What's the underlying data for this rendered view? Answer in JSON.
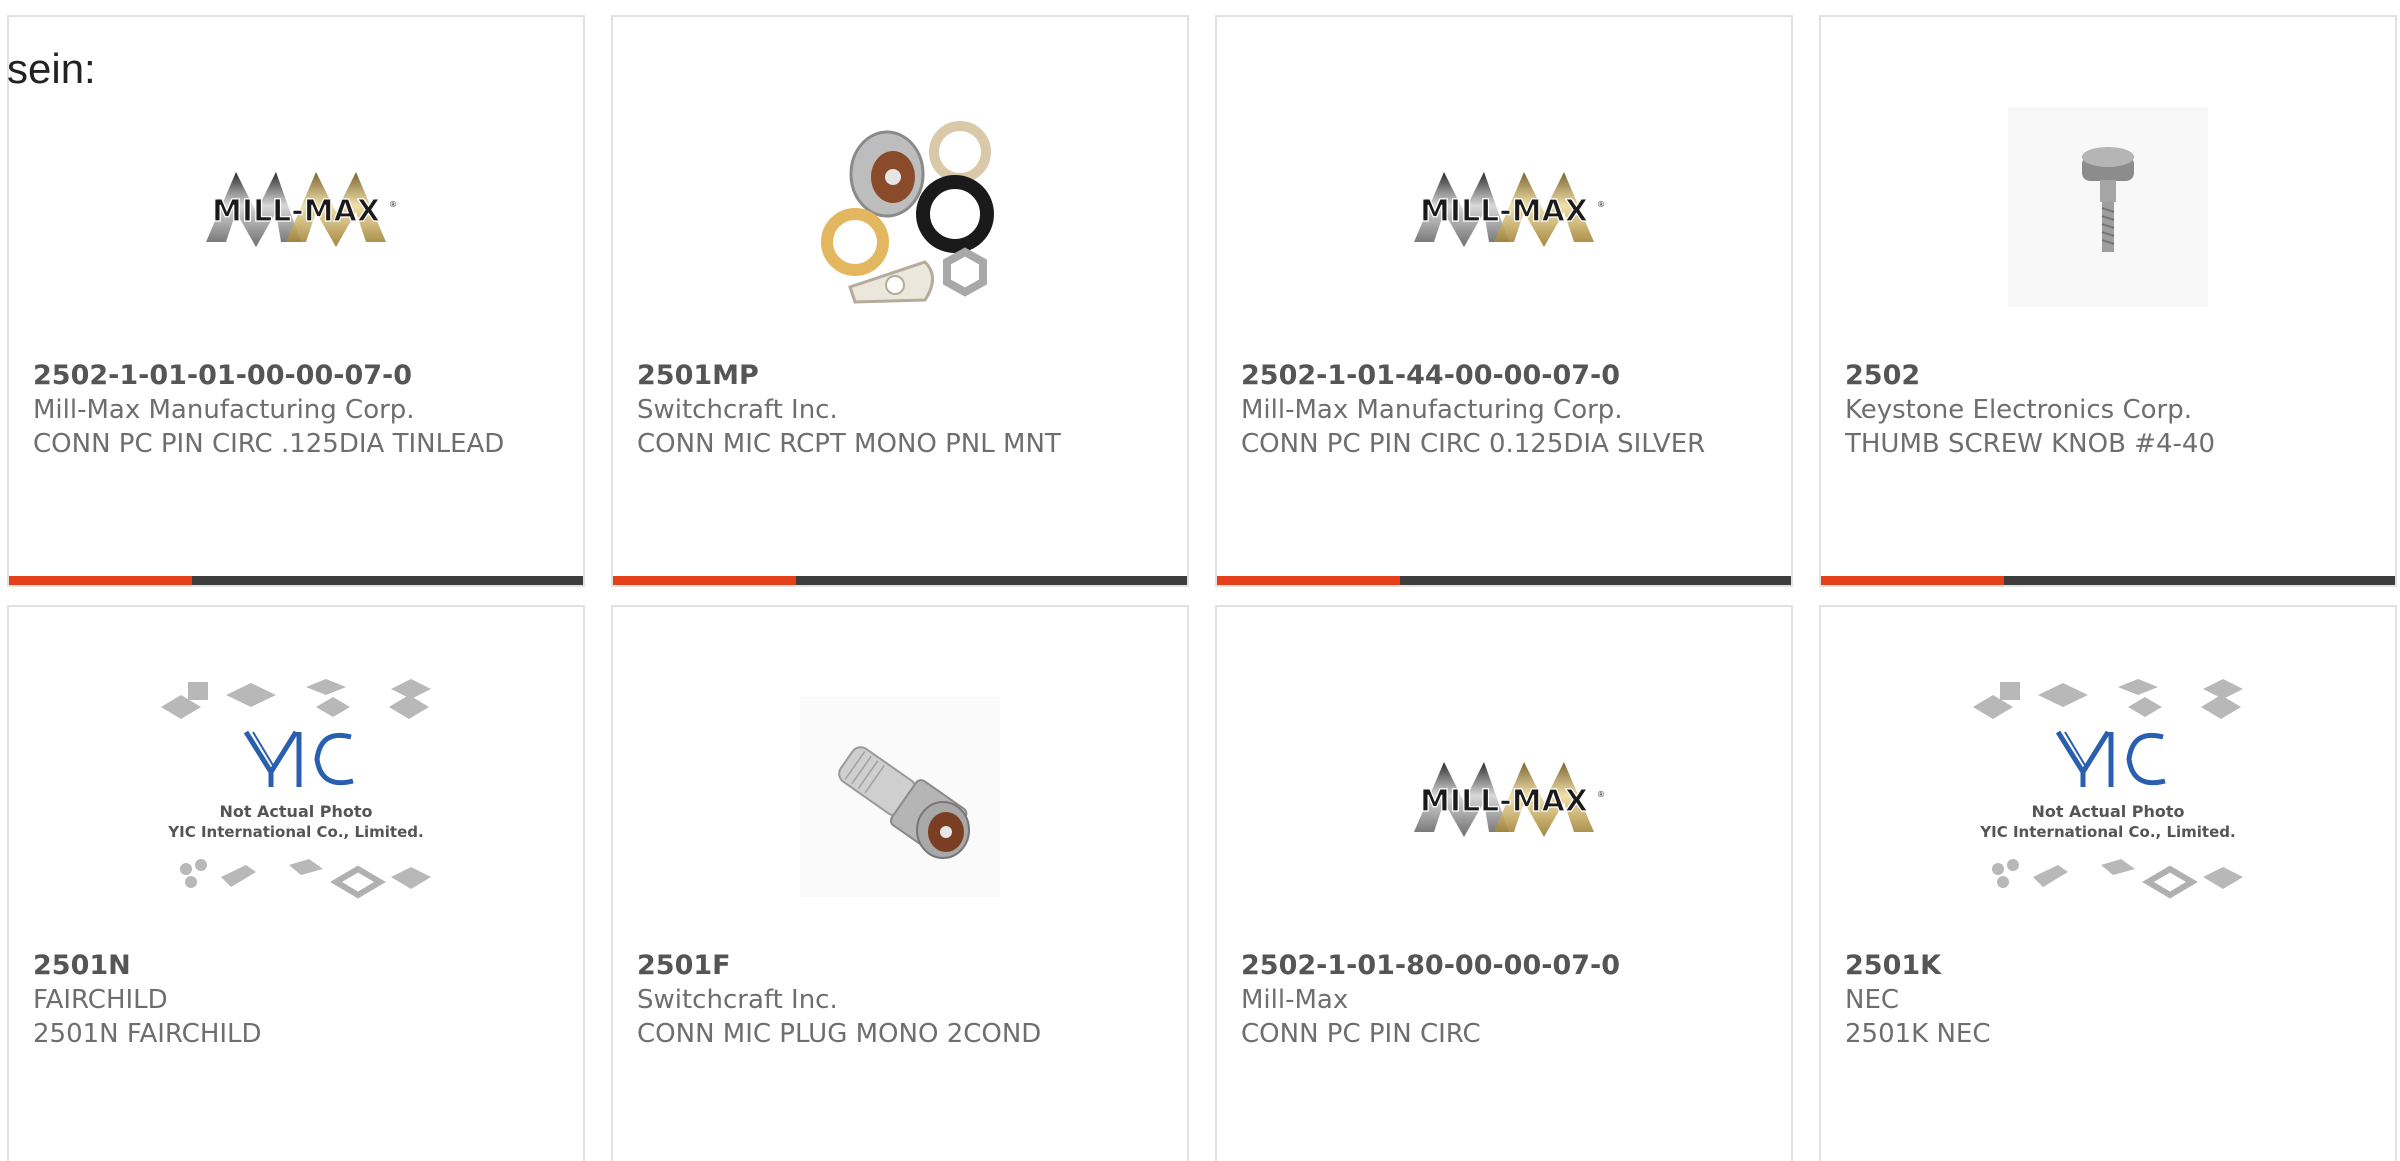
{
  "corner_label": "sein:",
  "products": [
    {
      "part": "2502-1-01-01-00-00-07-0",
      "manufacturer": "Mill-Max Manufacturing Corp.",
      "description": "CONN PC PIN CIRC .125DIA TINLEAD",
      "image": "millmax-logo",
      "logo_text": "MILL-MAX",
      "logo_mark": "®"
    },
    {
      "part": "2501MP",
      "manufacturer": "Switchcraft Inc.",
      "description": "CONN MIC RCPT MONO PNL MNT",
      "image": "mic-receptacle-photo"
    },
    {
      "part": "2502-1-01-44-00-00-07-0",
      "manufacturer": "Mill-Max Manufacturing Corp.",
      "description": "CONN PC PIN CIRC 0.125DIA SILVER",
      "image": "millmax-logo",
      "logo_text": "MILL-MAX",
      "logo_mark": "®"
    },
    {
      "part": "2502",
      "manufacturer": "Keystone Electronics Corp.",
      "description": "THUMB SCREW KNOB #4-40",
      "image": "thumb-screw-photo"
    },
    {
      "part": "2501N",
      "manufacturer": "FAIRCHILD",
      "description": "2501N FAIRCHILD",
      "image": "yic-placeholder",
      "placeholder_logo": "YIC",
      "placeholder_line1": "Not Actual Photo",
      "placeholder_line2": "YIC International Co., Limited."
    },
    {
      "part": "2501F",
      "manufacturer": "Switchcraft Inc.",
      "description": "CONN MIC PLUG MONO 2COND",
      "image": "mic-plug-photo"
    },
    {
      "part": "2502-1-01-80-00-00-07-0",
      "manufacturer": "Mill-Max",
      "description": "CONN PC PIN CIRC",
      "image": "millmax-logo",
      "logo_text": "MILL-MAX",
      "logo_mark": "®"
    },
    {
      "part": "2501K",
      "manufacturer": "NEC",
      "description": "2501K NEC",
      "image": "yic-placeholder",
      "placeholder_logo": "YIC",
      "placeholder_line1": "Not Actual Photo",
      "placeholder_line2": "YIC International Co., Limited."
    }
  ],
  "colors": {
    "accent": "#e6401a",
    "bar": "#3d3d3d",
    "border": "#e2e2e2",
    "text": "#6e6e6e"
  }
}
